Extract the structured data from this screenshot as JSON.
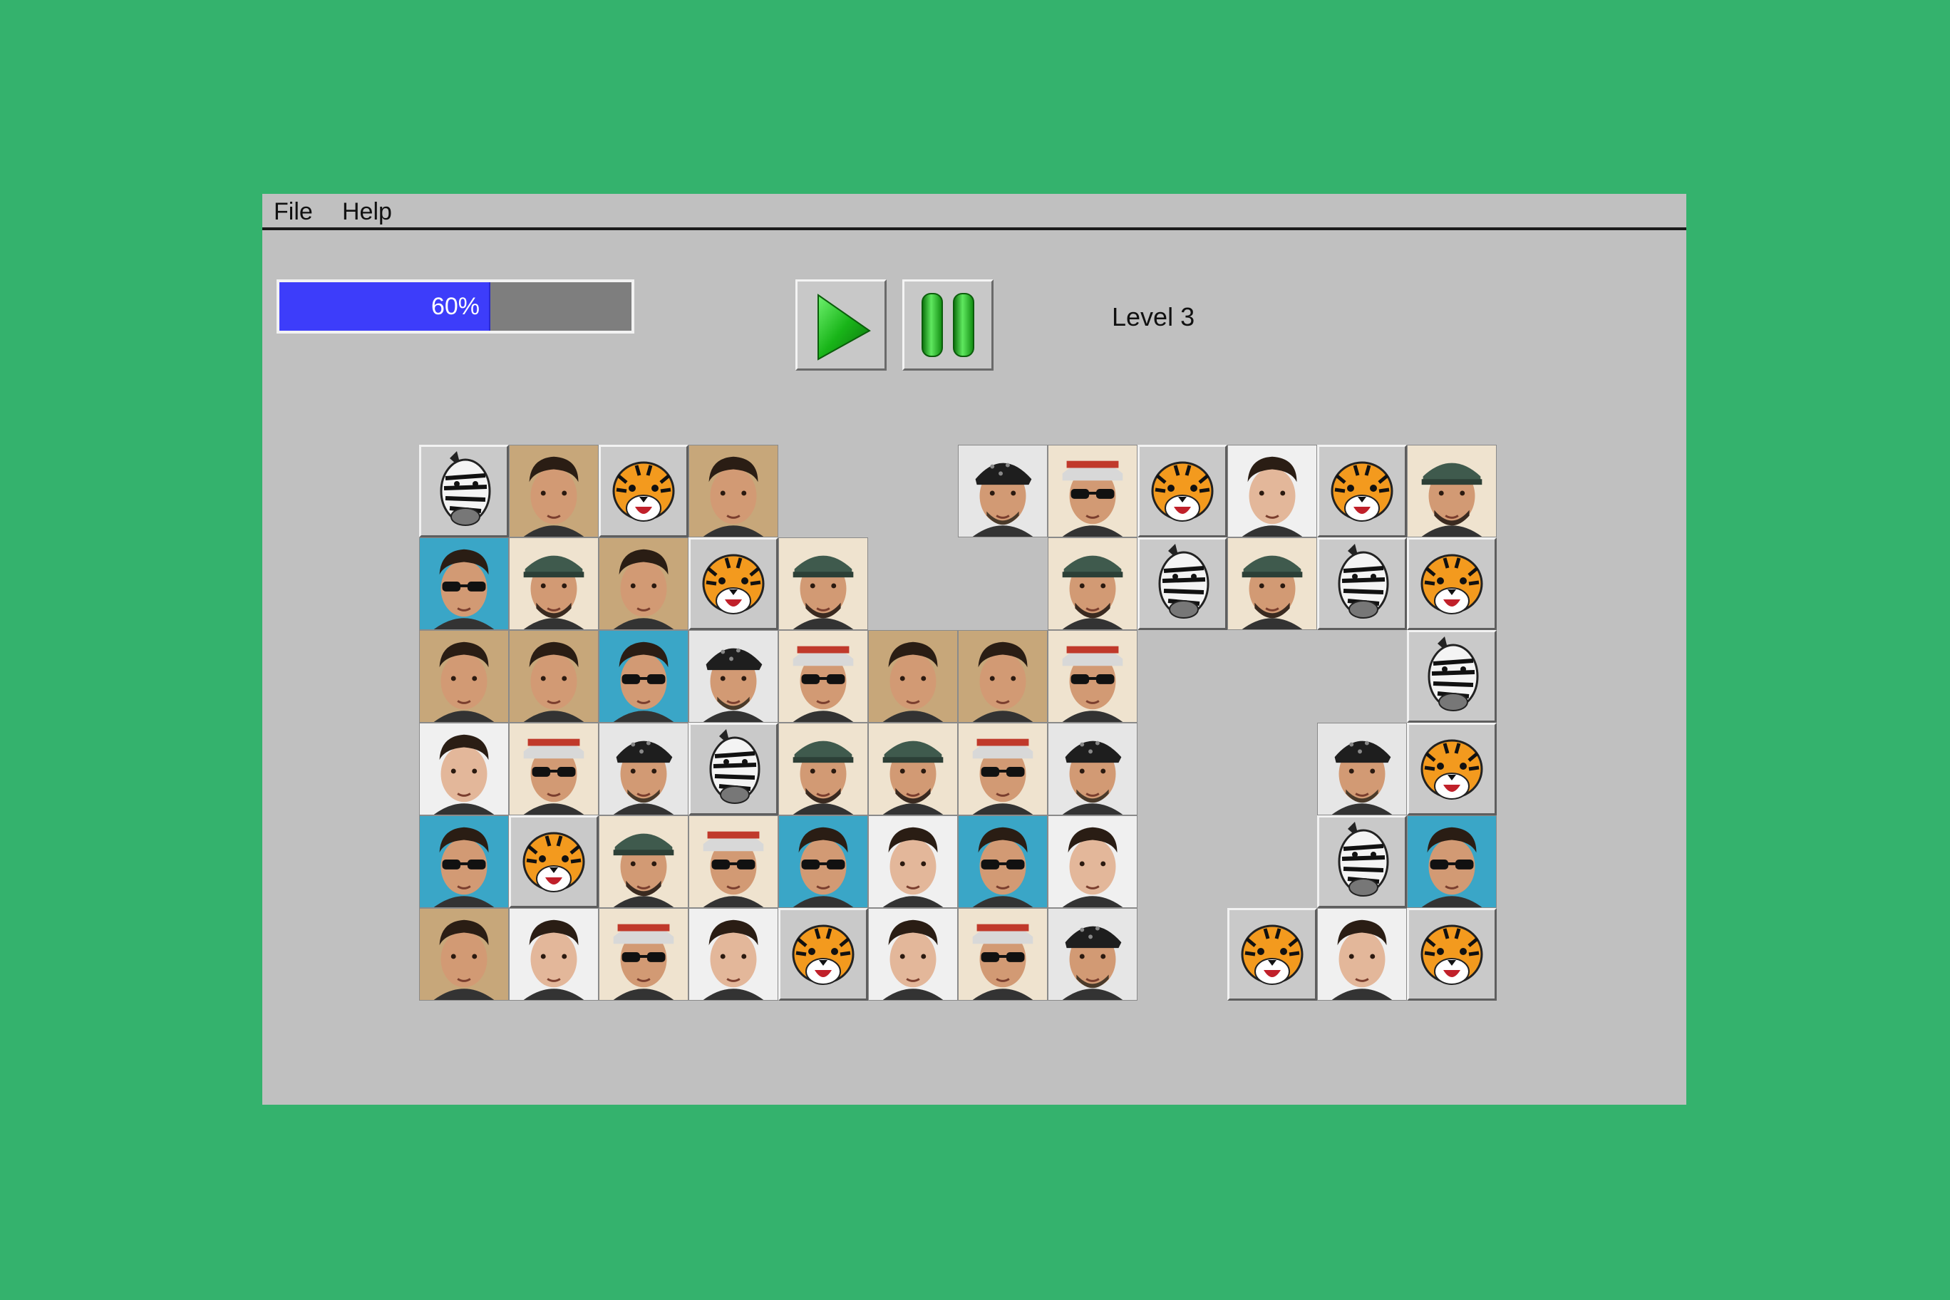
{
  "menu": {
    "file": "File",
    "help": "Help"
  },
  "progress": {
    "value": 0.6,
    "label": "60%"
  },
  "controls": {
    "play_icon": "play-icon",
    "pause_icon": "pause-icon"
  },
  "level": {
    "text": "Level 3"
  },
  "colors": {
    "background": "#34b26d",
    "window": "#c0c0c0",
    "progress_fill": "#3d3dfa",
    "progress_track": "#7e7e7e",
    "button_green": "#1db81d"
  },
  "board": {
    "rows": [
      [
        "zebra",
        "man-brown",
        "tiger",
        "man-brown",
        null,
        null,
        "man-bandana",
        "man-sunglasses-cap",
        "tiger",
        "man-dark",
        "tiger",
        "man-cap"
      ],
      [
        "man-sunglasses-blue",
        "man-cap",
        "man-brown",
        "tiger",
        "man-cap",
        null,
        null,
        "man-cap",
        "zebra",
        "man-cap",
        "zebra",
        "tiger"
      ],
      [
        "man-brown",
        "man-brown",
        "man-sunglasses-blue",
        "man-bandana",
        "man-sunglasses-cap",
        "man-brown",
        "man-brown",
        "man-sunglasses-cap",
        null,
        null,
        null,
        "zebra"
      ],
      [
        "man-dark",
        "man-sunglasses-cap",
        "man-bandana",
        "zebra",
        "man-cap",
        "man-cap",
        "man-sunglasses-cap",
        "man-bandana",
        null,
        null,
        "man-bandana",
        "tiger"
      ],
      [
        "man-sunglasses-blue",
        "tiger",
        "man-cap",
        "man-sunglasses-cap",
        "man-sunglasses-blue",
        "man-dark",
        "man-sunglasses-blue",
        "man-dark",
        null,
        null,
        "zebra",
        "man-sunglasses-blue"
      ],
      [
        "man-brown",
        "man-dark",
        "man-sunglasses-cap",
        "man-dark",
        "tiger",
        "man-dark",
        "man-sunglasses-cap",
        "man-bandana",
        null,
        "tiger",
        "man-dark",
        "tiger"
      ]
    ]
  }
}
